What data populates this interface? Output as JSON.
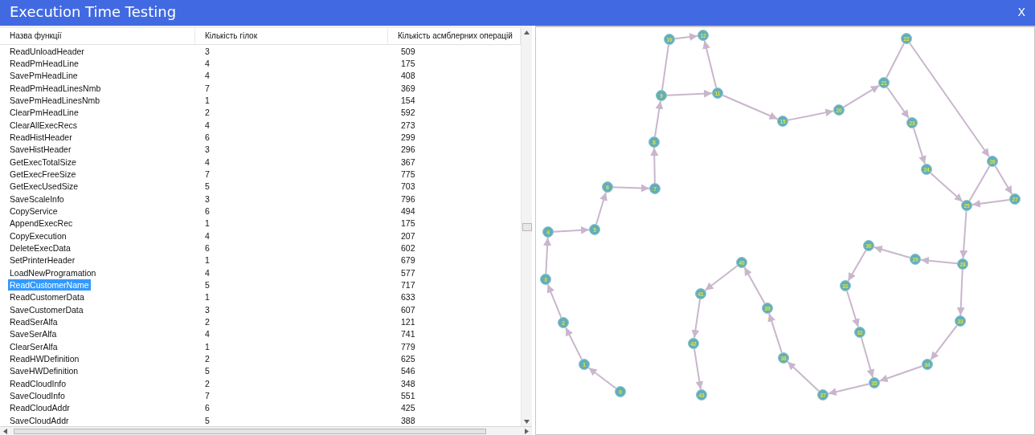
{
  "window": {
    "title": "Execution Time Testing",
    "close_label": "X"
  },
  "table": {
    "columns": [
      "Назва функції",
      "Кількість гілок",
      "Кількість асмблерних операцій"
    ],
    "rows": [
      {
        "cells": [
          "ReadUnloadHeader",
          "3",
          "509"
        ],
        "selected": false
      },
      {
        "cells": [
          "ReadPmHeadLine",
          "4",
          "175"
        ],
        "selected": false
      },
      {
        "cells": [
          "SavePmHeadLine",
          "4",
          "408"
        ],
        "selected": false
      },
      {
        "cells": [
          "ReadPmHeadLinesNmb",
          "7",
          "369"
        ],
        "selected": false
      },
      {
        "cells": [
          "SavePmHeadLinesNmb",
          "1",
          "154"
        ],
        "selected": false
      },
      {
        "cells": [
          "ClearPmHeadLine",
          "2",
          "592"
        ],
        "selected": false
      },
      {
        "cells": [
          "ClearAllExecRecs",
          "4",
          "273"
        ],
        "selected": false
      },
      {
        "cells": [
          "ReadHistHeader",
          "6",
          "299"
        ],
        "selected": false
      },
      {
        "cells": [
          "SaveHistHeader",
          "3",
          "296"
        ],
        "selected": false
      },
      {
        "cells": [
          "GetExecTotalSize",
          "4",
          "367"
        ],
        "selected": false
      },
      {
        "cells": [
          "GetExecFreeSize",
          "7",
          "775"
        ],
        "selected": false
      },
      {
        "cells": [
          "GetExecUsedSize",
          "5",
          "703"
        ],
        "selected": false
      },
      {
        "cells": [
          "SaveScaleInfo",
          "3",
          "796"
        ],
        "selected": false
      },
      {
        "cells": [
          "CopyService",
          "6",
          "494"
        ],
        "selected": false
      },
      {
        "cells": [
          "AppendExecRec",
          "1",
          "175"
        ],
        "selected": false
      },
      {
        "cells": [
          "CopyExecution",
          "4",
          "207"
        ],
        "selected": false
      },
      {
        "cells": [
          "DeleteExecData",
          "6",
          "602"
        ],
        "selected": false
      },
      {
        "cells": [
          "SetPrinterHeader",
          "1",
          "679"
        ],
        "selected": false
      },
      {
        "cells": [
          "LoadNewProgramation",
          "4",
          "577"
        ],
        "selected": false
      },
      {
        "cells": [
          "ReadCustomerName",
          "5",
          "717"
        ],
        "selected": true
      },
      {
        "cells": [
          "ReadCustomerData",
          "1",
          "633"
        ],
        "selected": false
      },
      {
        "cells": [
          "SaveCustomerData",
          "3",
          "607"
        ],
        "selected": false
      },
      {
        "cells": [
          "ReadSerAlfa",
          "2",
          "121"
        ],
        "selected": false
      },
      {
        "cells": [
          "SaveSerAlfa",
          "4",
          "741"
        ],
        "selected": false
      },
      {
        "cells": [
          "ClearSerAlfa",
          "1",
          "779"
        ],
        "selected": false
      },
      {
        "cells": [
          "ReadHWDefinition",
          "2",
          "625"
        ],
        "selected": false
      },
      {
        "cells": [
          "SaveHWDefinition",
          "5",
          "546"
        ],
        "selected": false
      },
      {
        "cells": [
          "ReadCloudInfo",
          "2",
          "348"
        ],
        "selected": false
      },
      {
        "cells": [
          "SaveCloudInfo",
          "7",
          "551"
        ],
        "selected": false
      },
      {
        "cells": [
          "ReadCloudAddr",
          "6",
          "425"
        ],
        "selected": false
      },
      {
        "cells": [
          "SaveCloudAddr",
          "5",
          "388"
        ],
        "selected": false
      }
    ]
  },
  "graph": {
    "nodes": [
      {
        "label": "0"
      },
      {
        "label": "1"
      },
      {
        "label": "2"
      },
      {
        "label": "3"
      },
      {
        "label": "4"
      },
      {
        "label": "5"
      },
      {
        "label": "6"
      },
      {
        "label": "7"
      },
      {
        "label": "8"
      },
      {
        "label": "9"
      },
      {
        "label": "10"
      },
      {
        "label": "11"
      },
      {
        "label": "12"
      },
      {
        "label": "15"
      },
      {
        "label": "20"
      },
      {
        "label": "21"
      },
      {
        "label": "22"
      },
      {
        "label": "23"
      },
      {
        "label": "24"
      },
      {
        "label": "25"
      },
      {
        "label": "26"
      },
      {
        "label": "27"
      },
      {
        "label": "28"
      },
      {
        "label": "29"
      },
      {
        "label": "30"
      },
      {
        "label": "31"
      },
      {
        "label": "32"
      },
      {
        "label": "33"
      },
      {
        "label": "34"
      },
      {
        "label": "35"
      },
      {
        "label": "37"
      },
      {
        "label": "38"
      },
      {
        "label": "39"
      },
      {
        "label": "40"
      },
      {
        "label": "41"
      },
      {
        "label": "42"
      },
      {
        "label": "43"
      }
    ]
  }
}
